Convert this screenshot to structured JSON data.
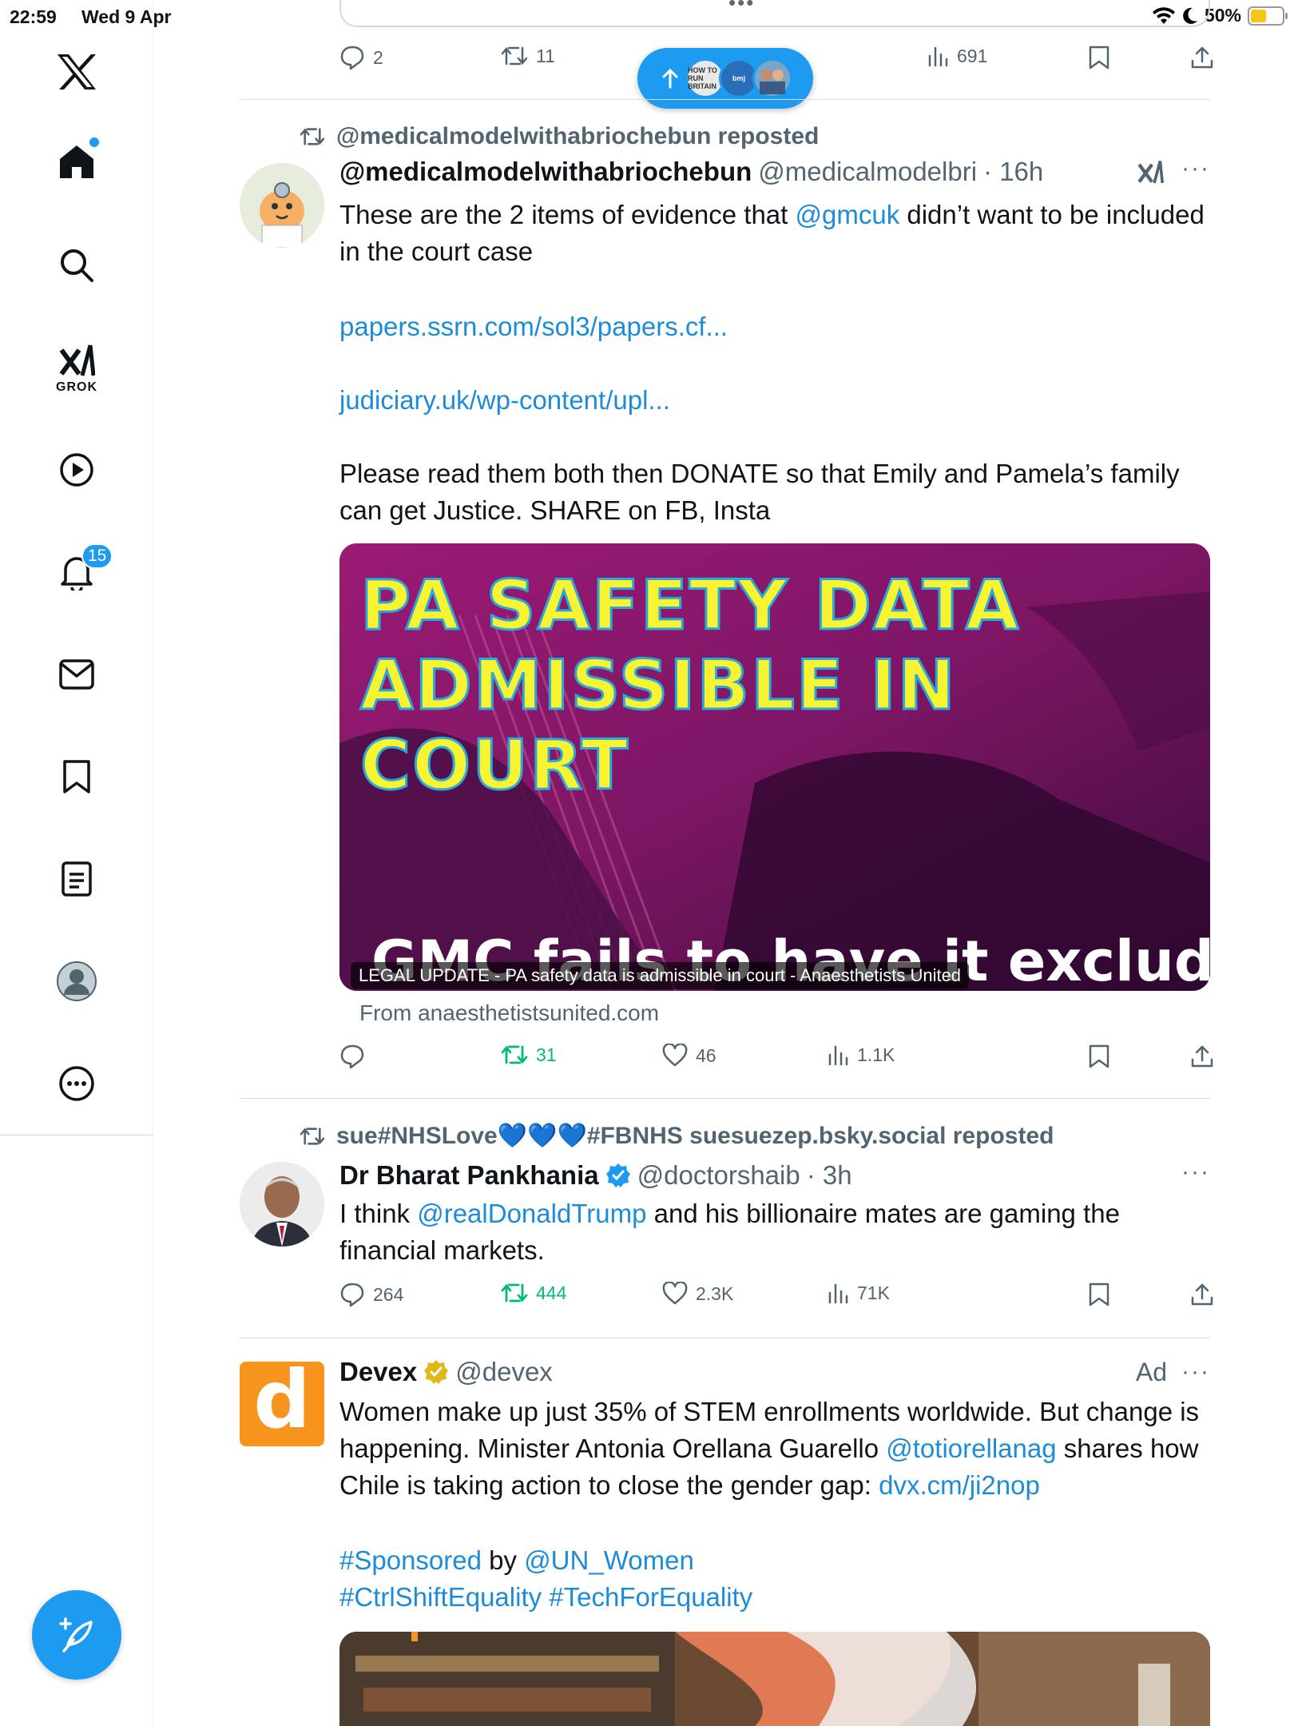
{
  "status_bar": {
    "time": "22:59",
    "date": "Wed 9 Apr",
    "battery": "50%",
    "battery_level": 0.5
  },
  "sidebar": {
    "items": [
      {
        "name": "x-logo"
      },
      {
        "name": "home"
      },
      {
        "name": "search"
      },
      {
        "name": "grok",
        "label": "GROK"
      },
      {
        "name": "video"
      },
      {
        "name": "notifications",
        "badge": "15"
      },
      {
        "name": "messages"
      },
      {
        "name": "bookmarks"
      },
      {
        "name": "lists"
      },
      {
        "name": "profile"
      },
      {
        "name": "more"
      }
    ]
  },
  "top_tweet": {
    "replies": "2",
    "reposts": "11",
    "views": "691"
  },
  "new_posts_pill": {
    "avatar_text_1": "HOW TO RUN BRITAIN",
    "avatar_text_2": "bmj"
  },
  "tweet1": {
    "repost_by": "@medicalmodelwithabriochebun reposted",
    "author": "@medicalmodelwithabriochebun",
    "handle": "@medicalmodelbri",
    "time": "· 16h",
    "text_1": "These are the 2 items of evidence that ",
    "mention_1": "@gmcuk",
    "text_2": " didn’t want to be included in the court case",
    "link_1": "papers.ssrn.com/sol3/papers.cf...",
    "link_2": "judiciary.uk/wp-content/upl...",
    "text_3": "Please read them both then DONATE  so that Emily and Pamela’s family can get Justice. SHARE on FB, Insta",
    "media_headline_1": "PA SAFETY DATA",
    "media_headline_2": "ADMISSIBLE IN COURT",
    "media_subheadline": "GMC fails to have it excluded",
    "media_caption": "LEGAL UPDATE - PA safety data is admissible in court - Anaesthetists United",
    "from": "From anaesthetistsunited.com",
    "reposts": "31",
    "likes": "46",
    "views": "1.1K"
  },
  "tweet2": {
    "repost_by": "sue#NHSLove💙💙💙#FBNHS suesuezep.bsky.social reposted",
    "author": "Dr Bharat Pankhania",
    "handle": "@doctorshaib",
    "time": "· 3h",
    "text_1": "I think ",
    "mention_1": "@realDonaldTrump",
    "text_2": " and his billionaire mates are gaming the financial markets.",
    "replies": "264",
    "reposts": "444",
    "likes": "2.3K",
    "views": "71K"
  },
  "tweet3": {
    "author": "Devex",
    "handle": "@devex",
    "ad_label": "Ad",
    "avatar_letter": "d",
    "text_1": "Women make up just 35% of STEM enrollments worldwide. But change is happening. Minister Antonia Orellana Guarello ",
    "mention_1": "@totiorellanag",
    "text_2": " shares how Chile is taking action to close the gender gap: ",
    "link_1": "dvx.cm/ji2nop",
    "hashtag_1": "#Sponsored",
    "text_3": " by ",
    "mention_2": "@UN_Women",
    "hashtag_2": "#CtrlShiftEquality",
    "hashtag_3": "#TechForEquality"
  },
  "colors": {
    "accent": "#1d9bf0",
    "repost_green": "#00ba7c",
    "muted": "#536471",
    "devex_orange": "#f7941d"
  }
}
